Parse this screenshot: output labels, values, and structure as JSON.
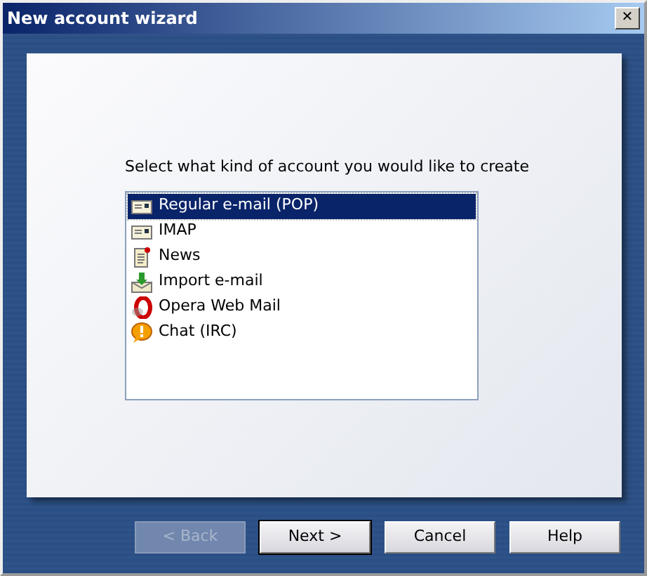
{
  "window": {
    "title": "New account wizard",
    "close": "✕"
  },
  "prompt": "Select what kind of account you would like to create",
  "accounts": [
    {
      "label": "Regular e-mail (POP)",
      "kind": "pop",
      "selected": true
    },
    {
      "label": "IMAP",
      "kind": "imap",
      "selected": false
    },
    {
      "label": "News",
      "kind": "news",
      "selected": false
    },
    {
      "label": "Import e-mail",
      "kind": "import",
      "selected": false
    },
    {
      "label": "Opera Web Mail",
      "kind": "webmail",
      "selected": false
    },
    {
      "label": "Chat (IRC)",
      "kind": "chat",
      "selected": false
    }
  ],
  "buttons": [
    {
      "label": "< Back",
      "disabled": true,
      "default": false
    },
    {
      "label": "Next >",
      "disabled": false,
      "default": true
    },
    {
      "label": "Cancel",
      "disabled": false,
      "default": false
    },
    {
      "label": "Help",
      "disabled": false,
      "default": false
    }
  ]
}
